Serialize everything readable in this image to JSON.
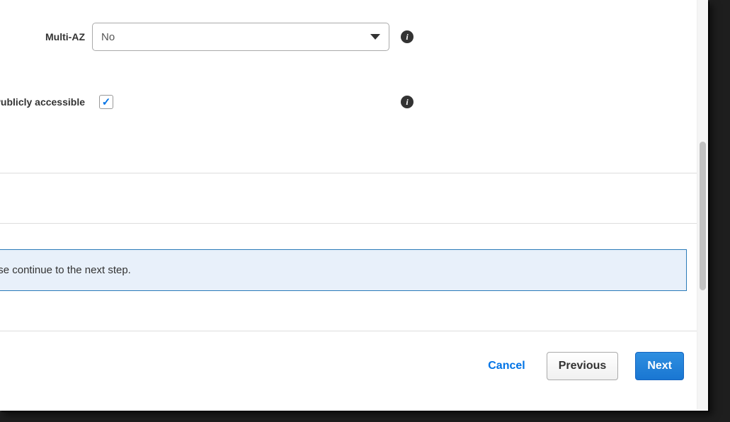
{
  "form": {
    "multiaz": {
      "label": "Multi-AZ",
      "value": "No"
    },
    "publicly_accessible": {
      "label": "Publicly accessible",
      "checked": true
    }
  },
  "alert": {
    "text": "started. Please continue to the next step."
  },
  "footer": {
    "cancel": "Cancel",
    "previous": "Previous",
    "next": "Next"
  }
}
